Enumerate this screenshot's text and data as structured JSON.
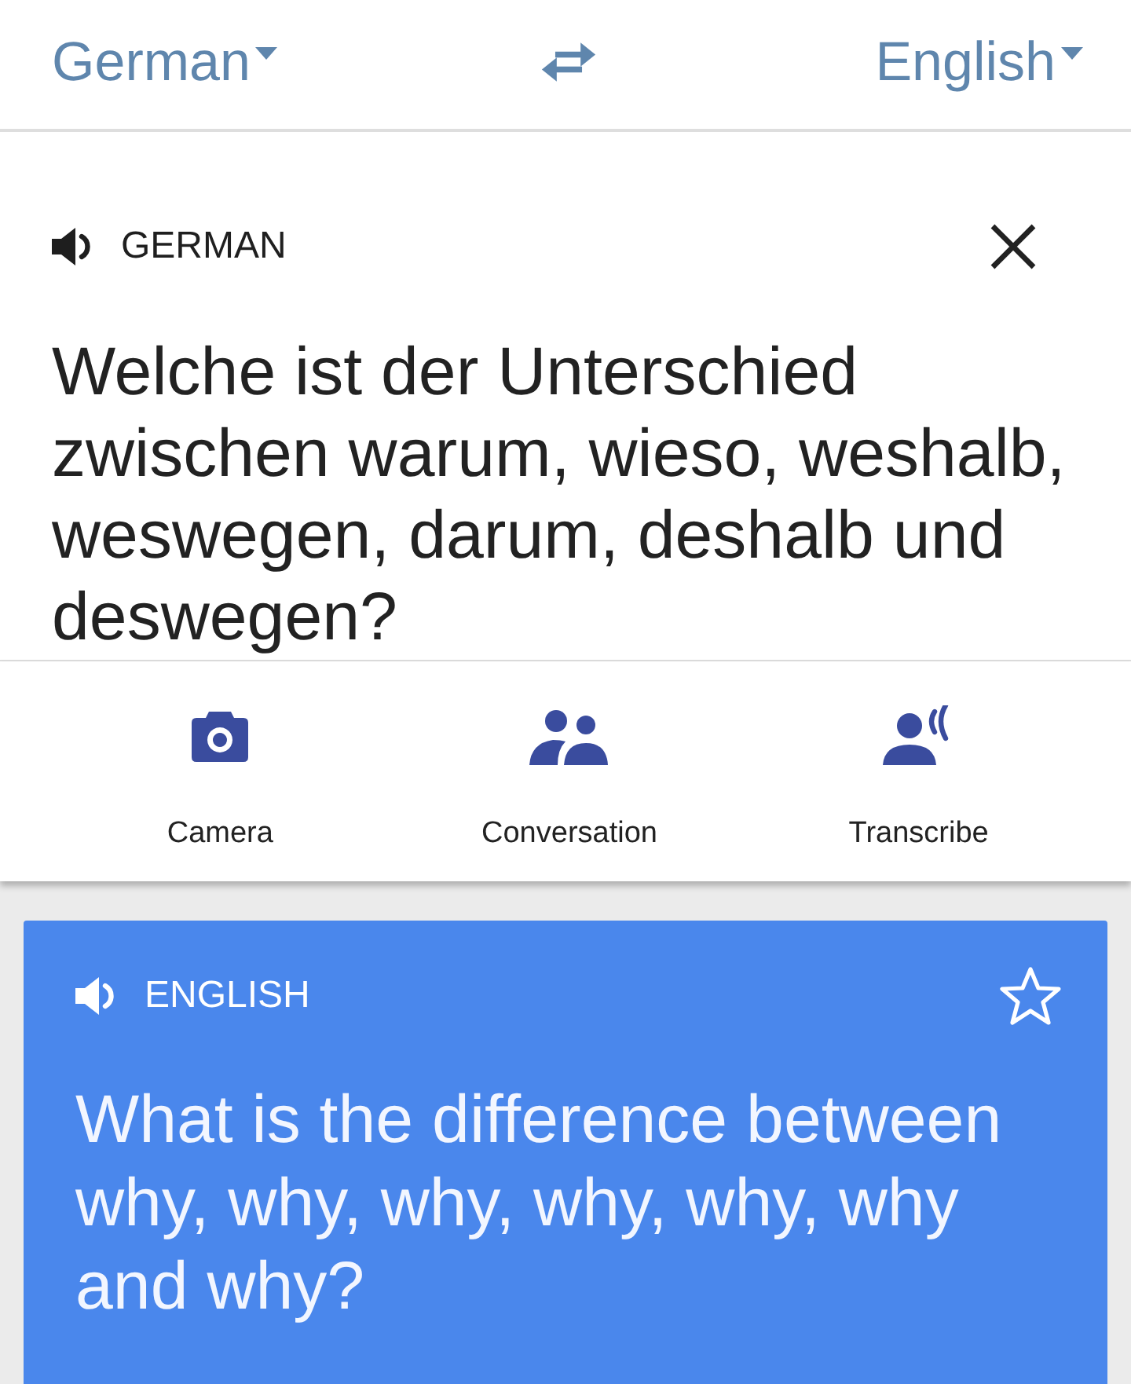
{
  "language_bar": {
    "source": {
      "label": "German"
    },
    "target": {
      "label": "English"
    }
  },
  "source_panel": {
    "language": "GERMAN",
    "text": "Welche ist der Unterschied zwischen warum, wieso, weshalb, weswegen, darum, deshalb und deswegen?"
  },
  "tools": [
    {
      "kind": "camera",
      "label": "Camera"
    },
    {
      "kind": "conversation",
      "label": "Conversation"
    },
    {
      "kind": "transcribe",
      "label": "Transcribe"
    }
  ],
  "result_card": {
    "language": "ENGLISH",
    "starred": false,
    "text": "What is the difference between why, why, why, why, why, why and why?"
  }
}
